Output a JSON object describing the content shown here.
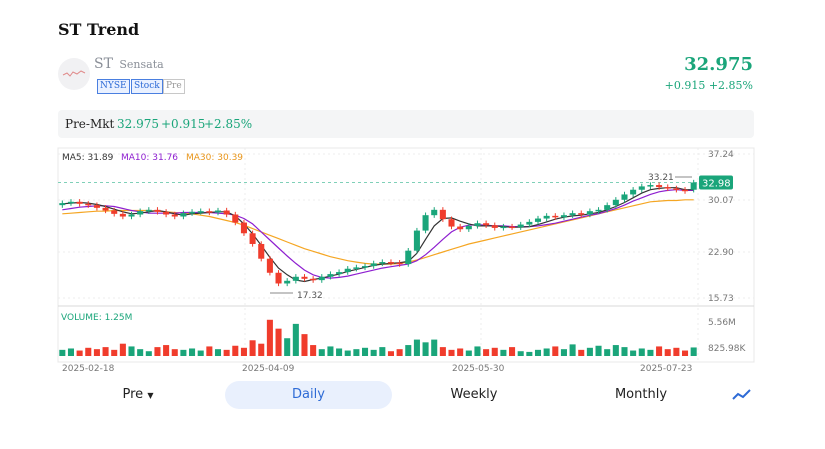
{
  "header": {
    "title": "ST Trend",
    "symbol": "ST",
    "name": "Sensata",
    "tags": [
      "NYSE",
      "Stock",
      "Pre"
    ],
    "price": "32.975",
    "change": "+0.915 +2.85%"
  },
  "premarket": {
    "label": "Pre-Mkt",
    "price": "32.975",
    "change": "+0.915",
    "change_pct": "+2.85%"
  },
  "legend": {
    "ma5": "MA5: 31.89",
    "ma10": "MA10: 31.76",
    "ma30": "MA30: 30.39",
    "volume": "VOLUME: 1.25M"
  },
  "colors": {
    "up": "#1aa57a",
    "down": "#f03c2c",
    "ma5": "#333333",
    "ma10": "#8e1fd0",
    "ma30": "#f5a623",
    "accent": "#2e6bd6"
  },
  "labels": {
    "high": "33.21",
    "low": "17.32",
    "current": "32.98"
  },
  "tabs": [
    "Pre",
    "Daily",
    "Weekly",
    "Monthly"
  ],
  "chart_data": {
    "type": "candlestick",
    "y_ticks": [
      "37.24",
      "30.07",
      "22.90",
      "15.73"
    ],
    "yrange": [
      15.73,
      37.24
    ],
    "volume_ticks": [
      "5.56M",
      "825.98K"
    ],
    "x_ticks": [
      "2025-02-18",
      "2025-04-09",
      "2025-05-30",
      "2025-07-23"
    ],
    "ma5": [
      29.8,
      29.9,
      30.0,
      29.9,
      29.7,
      29.4,
      29.0,
      28.6,
      28.3,
      28.4,
      28.6,
      28.8,
      28.6,
      28.3,
      28.1,
      28.3,
      28.4,
      28.5,
      28.6,
      28.6,
      28.0,
      26.8,
      25.3,
      23.6,
      21.8,
      20.2,
      19.2,
      18.4,
      18.2,
      18.5,
      18.7,
      19.0,
      19.3,
      19.7,
      20.0,
      20.3,
      20.6,
      20.8,
      20.9,
      21.0,
      21.2,
      22.4,
      24.5,
      26.5,
      27.6,
      27.7,
      27.2,
      26.8,
      26.5,
      26.5,
      26.5,
      26.4,
      26.3,
      26.3,
      26.4,
      26.7,
      27.1,
      27.5,
      27.8,
      28.0,
      28.1,
      28.3,
      28.5,
      28.9,
      29.4,
      30.0,
      30.7,
      31.4,
      31.9,
      32.1,
      32.2,
      32.2,
      31.9,
      31.9
    ],
    "ma10": [
      28.9,
      29.1,
      29.3,
      29.4,
      29.5,
      29.5,
      29.4,
      29.1,
      28.8,
      28.6,
      28.4,
      28.4,
      28.4,
      28.4,
      28.5,
      28.5,
      28.5,
      28.5,
      28.4,
      28.3,
      28.1,
      27.6,
      26.8,
      25.6,
      24.4,
      23.2,
      22.0,
      20.9,
      19.9,
      19.2,
      18.8,
      18.7,
      18.8,
      19.0,
      19.3,
      19.6,
      19.9,
      20.2,
      20.4,
      20.6,
      20.8,
      21.3,
      22.2,
      23.3,
      24.5,
      25.6,
      26.3,
      26.6,
      26.7,
      26.6,
      26.5,
      26.5,
      26.4,
      26.4,
      26.4,
      26.5,
      26.7,
      26.9,
      27.2,
      27.5,
      27.8,
      28.1,
      28.3,
      28.7,
      29.1,
      29.6,
      30.2,
      30.7,
      31.2,
      31.6,
      31.8,
      31.9,
      31.8,
      31.8
    ],
    "ma30": [
      28.3,
      28.4,
      28.5,
      28.6,
      28.7,
      28.7,
      28.8,
      28.8,
      28.8,
      28.8,
      28.8,
      28.7,
      28.6,
      28.5,
      28.4,
      28.3,
      28.1,
      27.9,
      27.6,
      27.3,
      27.0,
      26.6,
      26.1,
      25.6,
      25.1,
      24.6,
      24.1,
      23.6,
      23.1,
      22.7,
      22.3,
      21.9,
      21.6,
      21.3,
      21.1,
      20.9,
      20.8,
      20.8,
      20.8,
      20.9,
      21.1,
      21.4,
      21.8,
      22.2,
      22.6,
      23.0,
      23.4,
      23.8,
      24.1,
      24.4,
      24.7,
      25.0,
      25.3,
      25.6,
      25.9,
      26.2,
      26.5,
      26.8,
      27.1,
      27.4,
      27.7,
      28.0,
      28.3,
      28.6,
      28.9,
      29.2,
      29.5,
      29.8,
      30.1,
      30.2,
      30.3,
      30.3,
      30.4,
      30.4
    ],
    "closes": [
      29.9,
      30.1,
      29.8,
      29.6,
      29.2,
      28.8,
      28.3,
      27.9,
      28.2,
      28.7,
      28.9,
      28.6,
      28.2,
      27.9,
      28.4,
      28.6,
      28.7,
      28.5,
      28.8,
      28.2,
      27.0,
      25.4,
      23.8,
      21.6,
      19.5,
      17.9,
      18.3,
      18.9,
      18.6,
      18.4,
      18.9,
      19.3,
      19.6,
      20.1,
      20.3,
      20.5,
      20.9,
      21.1,
      21.0,
      20.8,
      22.8,
      25.8,
      28.1,
      28.9,
      27.5,
      26.4,
      26.0,
      26.5,
      26.9,
      26.6,
      26.2,
      26.4,
      26.3,
      26.7,
      27.1,
      27.6,
      28.0,
      27.8,
      28.1,
      28.4,
      28.2,
      28.7,
      28.9,
      29.6,
      30.4,
      31.2,
      31.9,
      32.4,
      32.6,
      32.3,
      32.1,
      31.9,
      31.7,
      32.98
    ],
    "opens": [
      29.6,
      29.9,
      30.1,
      29.8,
      29.6,
      29.2,
      28.8,
      28.3,
      27.9,
      28.2,
      28.7,
      28.9,
      28.6,
      28.2,
      27.9,
      28.4,
      28.6,
      28.7,
      28.5,
      28.8,
      28.2,
      27.0,
      25.4,
      23.8,
      21.6,
      19.5,
      17.9,
      18.3,
      18.9,
      18.6,
      18.4,
      18.9,
      19.3,
      19.6,
      20.1,
      20.3,
      20.5,
      20.9,
      21.1,
      21.0,
      20.8,
      22.8,
      25.8,
      28.1,
      28.9,
      27.5,
      26.4,
      26.0,
      26.5,
      26.9,
      26.6,
      26.2,
      26.4,
      26.3,
      26.7,
      27.1,
      27.6,
      28.0,
      27.8,
      28.1,
      28.4,
      28.2,
      28.7,
      28.9,
      29.6,
      30.4,
      31.2,
      31.9,
      32.4,
      32.6,
      32.3,
      32.1,
      31.9,
      31.9
    ],
    "volumes": [
      0.9,
      1.1,
      0.8,
      1.2,
      1.0,
      1.3,
      0.9,
      1.8,
      1.4,
      1.0,
      0.7,
      1.3,
      1.6,
      1.0,
      0.9,
      1.1,
      0.8,
      1.4,
      1.0,
      0.9,
      1.5,
      1.2,
      2.3,
      1.8,
      5.3,
      4.0,
      2.6,
      4.7,
      3.2,
      1.6,
      1.0,
      1.4,
      1.1,
      0.8,
      1.0,
      1.2,
      0.9,
      1.3,
      0.7,
      1.0,
      1.6,
      2.4,
      2.0,
      2.4,
      1.3,
      0.9,
      1.1,
      0.8,
      1.4,
      1.0,
      1.2,
      0.9,
      1.3,
      0.7,
      0.6,
      0.9,
      1.1,
      1.4,
      1.0,
      1.7,
      0.9,
      1.2,
      1.5,
      1.0,
      1.6,
      1.3,
      0.8,
      1.1,
      0.9,
      1.4,
      1.0,
      1.2,
      0.8,
      1.25
    ]
  }
}
